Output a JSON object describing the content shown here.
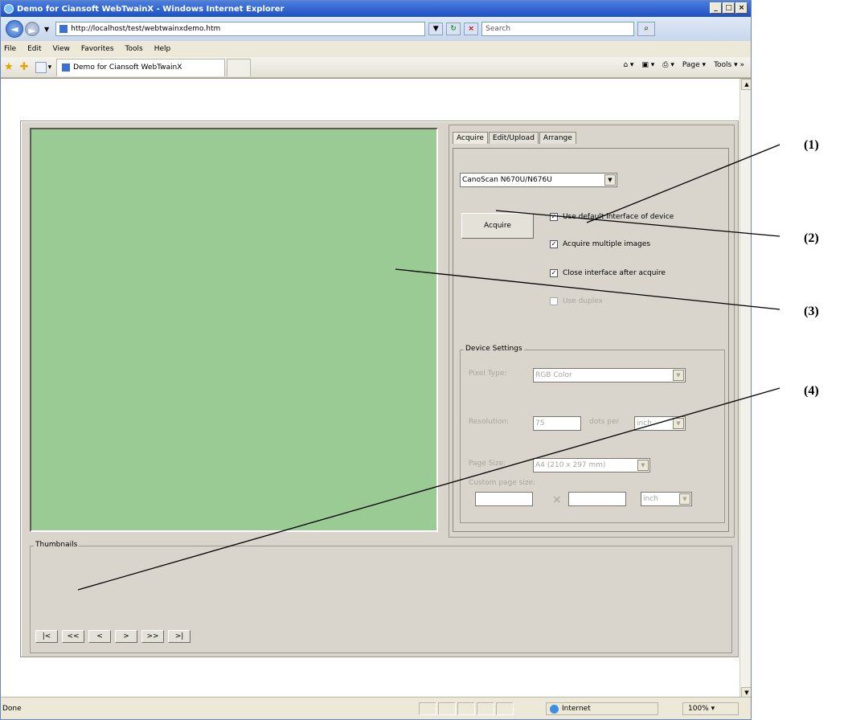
{
  "window": {
    "title": "Demo for Ciansoft WebTwainX - Windows Internet Explorer",
    "controls": [
      "_",
      "□",
      "×"
    ]
  },
  "address": {
    "url": "http://localhost/test/webtwainxdemo.htm",
    "search_placeholder": "Search"
  },
  "menu": [
    "File",
    "Edit",
    "View",
    "Favorites",
    "Tools",
    "Help"
  ],
  "favbar": {
    "tab_title": "Demo for Ciansoft WebTwainX",
    "page_label": "Page",
    "tools_label": "Tools"
  },
  "app": {
    "tabs": [
      "Acquire",
      "Edit/Upload",
      "Arrange"
    ],
    "device_select": "CanoScan N670U/N676U",
    "acquire_button": "Acquire",
    "checkboxes": [
      {
        "label": "Use default interface of device",
        "checked": true,
        "enabled": true
      },
      {
        "label": "Acquire multiple images",
        "checked": true,
        "enabled": true
      },
      {
        "label": "Close interface after acquire",
        "checked": true,
        "enabled": true
      },
      {
        "label": "Use duplex",
        "checked": false,
        "enabled": false
      }
    ],
    "device_settings": {
      "legend": "Device Settings",
      "pixel_type_label": "Pixel Type:",
      "pixel_type_value": "RGB Color",
      "resolution_label": "Resolution:",
      "resolution_value": "75",
      "dots_per_label": "dots per",
      "dots_per_unit": "inch",
      "page_size_label": "Page Size:",
      "page_size_value": "A4 (210 x 297 mm)",
      "custom_size_label": "Custom page size:",
      "times_sign": "×",
      "custom_unit": "inch"
    },
    "thumbnails": {
      "legend": "Thumbnails",
      "nav": [
        "|<",
        "<<",
        "<",
        ">",
        ">>",
        ">|"
      ]
    }
  },
  "status": {
    "text": "Done",
    "zone": "Internet",
    "zoom": "100%"
  },
  "annotations": [
    "(1)",
    "(2)",
    "(3)",
    "(4)"
  ],
  "colors": {
    "viewer": "#9acb95",
    "titlebar": "#1e4fc1"
  }
}
